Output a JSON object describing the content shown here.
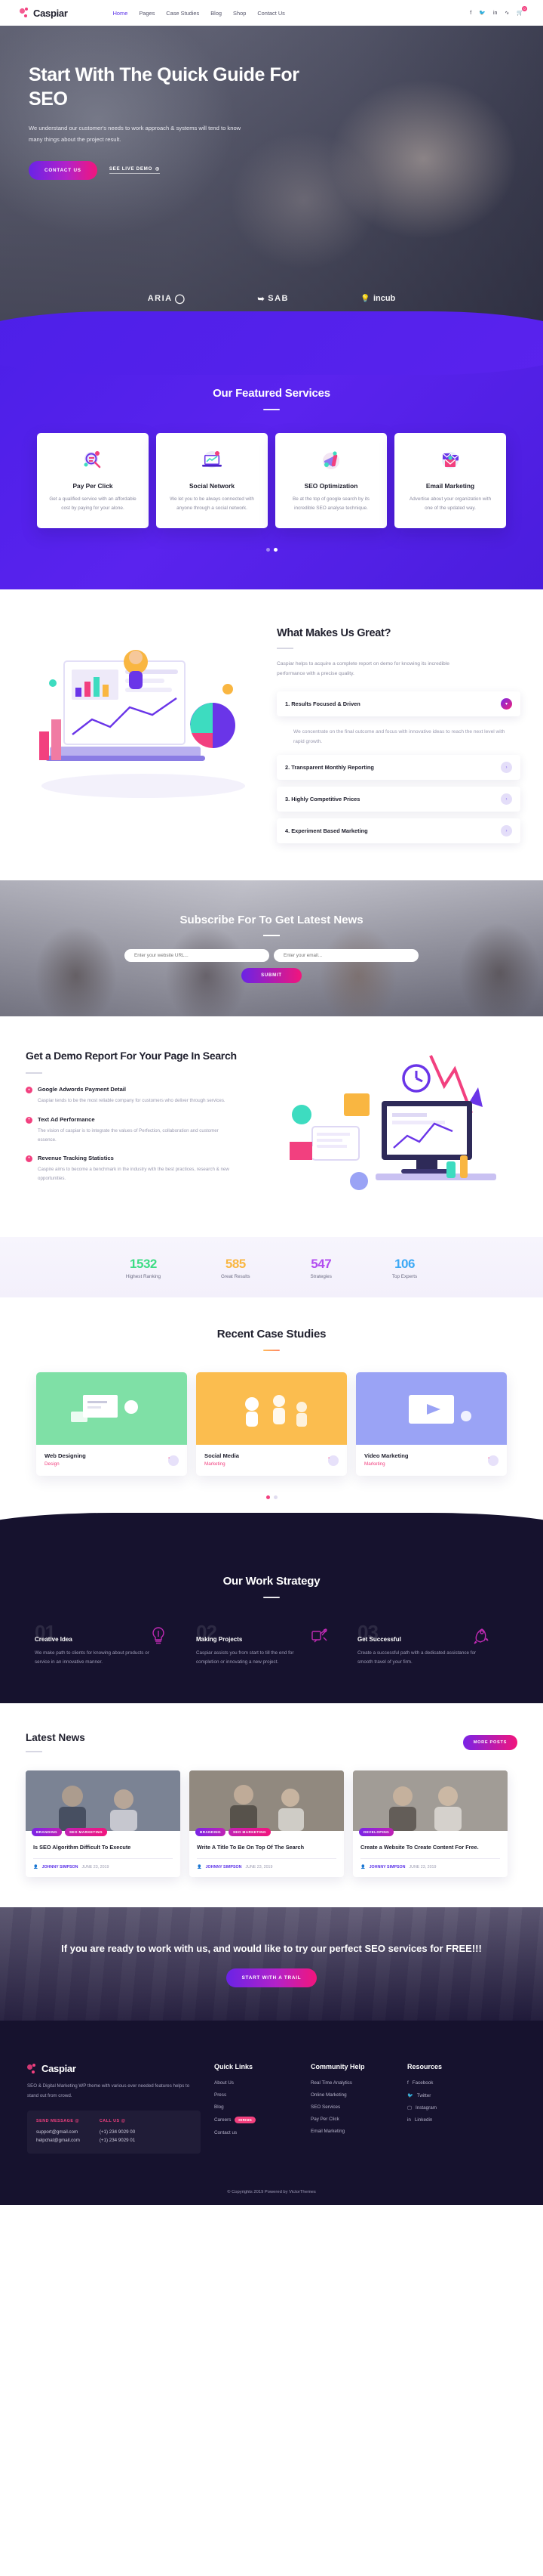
{
  "header": {
    "brand": "Caspiar",
    "nav": [
      {
        "label": "Home",
        "active": true
      },
      {
        "label": "Pages",
        "active": false
      },
      {
        "label": "Case Studies",
        "active": false
      },
      {
        "label": "Blog",
        "active": false
      },
      {
        "label": "Shop",
        "active": false
      },
      {
        "label": "Contact Us",
        "active": false
      }
    ],
    "social": [
      "facebook-icon",
      "twitter-icon",
      "linkedin-icon",
      "rss-icon"
    ],
    "cart_count": "0"
  },
  "hero": {
    "title": "Start With The Quick Guide For SEO",
    "subtitle": "We understand our customer's needs to work approach & systems will tend to know many things about the project result.",
    "primary_cta": "CONTACT US",
    "secondary_cta": "SEE LIVE DEMO",
    "clients": [
      "ARIA",
      "SAB",
      "incub"
    ]
  },
  "services": {
    "title": "Our Featured Services",
    "items": [
      {
        "icon": "magnifier-chart-icon",
        "title": "Pay Per Click",
        "desc": "Get a qualified service with an affordable cost by paying for your alone."
      },
      {
        "icon": "laptop-graph-icon",
        "title": "Social Network",
        "desc": "We let you to be always connected with anyone through a social network."
      },
      {
        "icon": "megaphone-icon",
        "title": "SEO Optimization",
        "desc": "Be at the top of google search by its incredible SEO analyse technique."
      },
      {
        "icon": "envelopes-icon",
        "title": "Email Marketing",
        "desc": "Advertise about your organization with one of the updated way."
      }
    ],
    "slider_dots": 2,
    "active_dot": 1
  },
  "great": {
    "title": "What Makes Us Great?",
    "lead": "Caspiar helps to acquire a complete report on demo for knowing its incredible performance with a precise quality.",
    "accordion": [
      {
        "title": "1. Results Focused & Driven",
        "open": true,
        "body": "We concentrate on the final outcome and focus with innovative ideas to reach the next level with rapid growth."
      },
      {
        "title": "2. Transparent Monthly Reporting",
        "open": false,
        "body": ""
      },
      {
        "title": "3. Highly Competitive Prices",
        "open": false,
        "body": ""
      },
      {
        "title": "4. Experiment Based Marketing",
        "open": false,
        "body": ""
      }
    ]
  },
  "subscribe": {
    "title": "Subscribe For To Get Latest News",
    "url_placeholder": "Enter your website URL...",
    "email_placeholder": "Enter your email...",
    "submit_label": "SUBMIT"
  },
  "demo": {
    "title": "Get a Demo Report For Your Page In Search",
    "features": [
      {
        "title": "Google Adwords Payment Detail",
        "desc": "Caspiar tends to be the most reliable company for customers who deliver through services."
      },
      {
        "title": "Text Ad Performance",
        "desc": "The vision of caspiar is to integrate the values of Perfection, collaboration and customer essence."
      },
      {
        "title": "Revenue Tracking Statistics",
        "desc": "Caspire aims to become a benchmark in the industry with the best practices, research & new opportunities."
      }
    ]
  },
  "stats": [
    {
      "value": "1532",
      "label": "Highest Ranking",
      "color": "#3ddc84"
    },
    {
      "value": "585",
      "label": "Great Results",
      "color": "#f9b641"
    },
    {
      "value": "547",
      "label": "Strategies",
      "color": "#b24cf0"
    },
    {
      "value": "106",
      "label": "Top Experts",
      "color": "#3da9f5"
    }
  ],
  "cases": {
    "title": "Recent Case Studies",
    "items": [
      {
        "title": "Web Designing",
        "category": "Design",
        "color": "#7fe0a6"
      },
      {
        "title": "Social Media",
        "category": "Marketing",
        "color": "#fbbd4f"
      },
      {
        "title": "Video Marketing",
        "category": "Marketing",
        "color": "#9aa3f5"
      }
    ],
    "slider_dots": 2,
    "active_dot": 0
  },
  "strategy": {
    "title": "Our Work Strategy",
    "steps": [
      {
        "num": "01",
        "icon": "bulb-idea-icon",
        "title": "Creative Idea",
        "desc": "We make path to clients for knowing about products or service in an innovative manner."
      },
      {
        "num": "02",
        "icon": "puzzle-rocket-icon",
        "title": "Making Projects",
        "desc": "Caspiar assists you from start to till the end for completion or innovating a new project."
      },
      {
        "num": "03",
        "icon": "rocket-icon",
        "title": "Get Successful",
        "desc": "Create a successful path with a dedicated assistance for smooth travel of your firm."
      }
    ]
  },
  "news": {
    "title": "Latest News",
    "more_label": "MORE POSTS",
    "posts": [
      {
        "tags": [
          "BRANDING",
          "SEO MARKETING"
        ],
        "title": "Is SEO Algorithm Difficult To Execute",
        "author": "JOHNNY SIMPSON",
        "date": "JUNE 23, 2019"
      },
      {
        "tags": [
          "BRANDING",
          "SEO MARKETING"
        ],
        "title": "Write A Title To Be On Top Of The Search",
        "author": "JOHNNY SIMPSON",
        "date": "JUNE 23, 2019"
      },
      {
        "tags": [
          "DEVELOPING"
        ],
        "title": "Create a Website To Create Content For Free.",
        "author": "JOHNNY SIMPSON",
        "date": "JUNE 23, 2019"
      }
    ]
  },
  "cta": {
    "title": "If you are ready to work with us, and would like to try our perfect SEO services for FREE!!!",
    "button": "START WITH A TRAIL"
  },
  "footer": {
    "brand": "Caspiar",
    "about": "SEO & Digital Marketing WP theme with various ever needed features helps to stand out from crowd.",
    "contact": {
      "message_label": "SEND MESSAGE @",
      "emails": [
        "support@gmail.com",
        "helpchat@gmail.com"
      ],
      "call_label": "CALL US @",
      "phones": [
        "(+1) 234 9029 00",
        "(+1) 234 9029 01"
      ]
    },
    "columns": [
      {
        "title": "Quick Links",
        "links": [
          {
            "label": "About Us"
          },
          {
            "label": "Press"
          },
          {
            "label": "Blog"
          },
          {
            "label": "Careers",
            "badge": "HIRING"
          },
          {
            "label": "Contact us"
          }
        ]
      },
      {
        "title": "Community Help",
        "links": [
          {
            "label": "Real Time Analytics"
          },
          {
            "label": "Online Marketing"
          },
          {
            "label": "SEO Services"
          },
          {
            "label": "Pay Per Click"
          },
          {
            "label": "Email Marketing"
          }
        ]
      },
      {
        "title": "Resources",
        "links": [
          {
            "label": "Facebook",
            "icon": "facebook-icon"
          },
          {
            "label": "Twitter",
            "icon": "twitter-icon"
          },
          {
            "label": "Instagram",
            "icon": "instagram-icon"
          },
          {
            "label": "Linkedin",
            "icon": "linkedin-icon"
          }
        ]
      }
    ],
    "copyright": "© Copyrights 2019 Powered by VictorThemes"
  }
}
